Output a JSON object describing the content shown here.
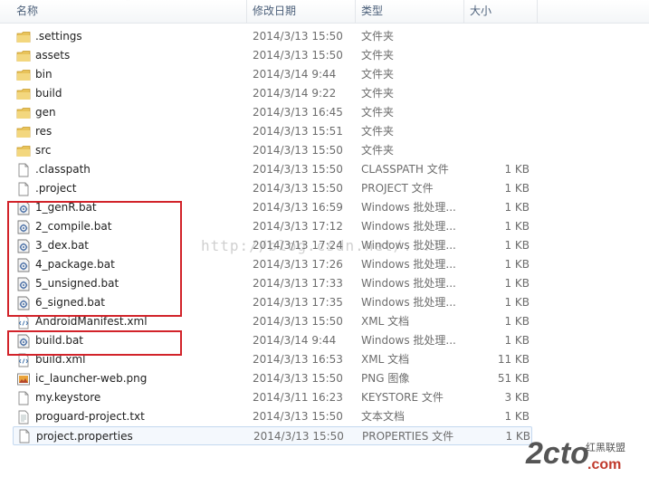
{
  "columns": {
    "name": "名称",
    "date": "修改日期",
    "type": "类型",
    "size": "大小"
  },
  "files": [
    {
      "name": ".settings",
      "date": "2014/3/13 15:50",
      "type": "文件夹",
      "size": "",
      "icon": "folder-icon"
    },
    {
      "name": "assets",
      "date": "2014/3/13 15:50",
      "type": "文件夹",
      "size": "",
      "icon": "folder-icon"
    },
    {
      "name": "bin",
      "date": "2014/3/14 9:44",
      "type": "文件夹",
      "size": "",
      "icon": "folder-icon"
    },
    {
      "name": "build",
      "date": "2014/3/14 9:22",
      "type": "文件夹",
      "size": "",
      "icon": "folder-icon"
    },
    {
      "name": "gen",
      "date": "2014/3/13 16:45",
      "type": "文件夹",
      "size": "",
      "icon": "folder-icon"
    },
    {
      "name": "res",
      "date": "2014/3/13 15:51",
      "type": "文件夹",
      "size": "",
      "icon": "folder-icon"
    },
    {
      "name": "src",
      "date": "2014/3/13 15:50",
      "type": "文件夹",
      "size": "",
      "icon": "folder-icon"
    },
    {
      "name": ".classpath",
      "date": "2014/3/13 15:50",
      "type": "CLASSPATH 文件",
      "size": "1 KB",
      "icon": "file-icon"
    },
    {
      "name": ".project",
      "date": "2014/3/13 15:50",
      "type": "PROJECT 文件",
      "size": "1 KB",
      "icon": "file-icon"
    },
    {
      "name": "1_genR.bat",
      "date": "2014/3/13 16:59",
      "type": "Windows 批处理...",
      "size": "1 KB",
      "icon": "batch-file-icon"
    },
    {
      "name": "2_compile.bat",
      "date": "2014/3/13 17:12",
      "type": "Windows 批处理...",
      "size": "1 KB",
      "icon": "batch-file-icon"
    },
    {
      "name": "3_dex.bat",
      "date": "2014/3/13 17:24",
      "type": "Windows 批处理...",
      "size": "1 KB",
      "icon": "batch-file-icon"
    },
    {
      "name": "4_package.bat",
      "date": "2014/3/13 17:26",
      "type": "Windows 批处理...",
      "size": "1 KB",
      "icon": "batch-file-icon"
    },
    {
      "name": "5_unsigned.bat",
      "date": "2014/3/13 17:33",
      "type": "Windows 批处理...",
      "size": "1 KB",
      "icon": "batch-file-icon"
    },
    {
      "name": "6_signed.bat",
      "date": "2014/3/13 17:35",
      "type": "Windows 批处理...",
      "size": "1 KB",
      "icon": "batch-file-icon"
    },
    {
      "name": "AndroidManifest.xml",
      "date": "2014/3/13 15:50",
      "type": "XML 文档",
      "size": "1 KB",
      "icon": "xml-file-icon"
    },
    {
      "name": "build.bat",
      "date": "2014/3/14 9:44",
      "type": "Windows 批处理...",
      "size": "1 KB",
      "icon": "batch-file-icon"
    },
    {
      "name": "build.xml",
      "date": "2014/3/13 16:53",
      "type": "XML 文档",
      "size": "11 KB",
      "icon": "xml-file-icon"
    },
    {
      "name": "ic_launcher-web.png",
      "date": "2014/3/13 15:50",
      "type": "PNG 图像",
      "size": "51 KB",
      "icon": "image-file-icon"
    },
    {
      "name": "my.keystore",
      "date": "2014/3/11 16:23",
      "type": "KEYSTORE 文件",
      "size": "3 KB",
      "icon": "file-icon"
    },
    {
      "name": "proguard-project.txt",
      "date": "2014/3/13 15:50",
      "type": "文本文档",
      "size": "1 KB",
      "icon": "text-file-icon"
    },
    {
      "name": "project.properties",
      "date": "2014/3/13 15:50",
      "type": "PROPERTIES 文件",
      "size": "1 KB",
      "icon": "file-icon",
      "selected": true
    }
  ],
  "colors": {
    "highlight_box": "#d2232a",
    "header_text": "#4c607a",
    "selection_border": "#c4d8ef",
    "folder": "#e8c35a"
  },
  "watermark": {
    "url_text": "http://blog.csdn.net/...l",
    "logo_text": "2cto",
    "logo_domain": ".com",
    "logo_cn": "红黑联盟"
  }
}
